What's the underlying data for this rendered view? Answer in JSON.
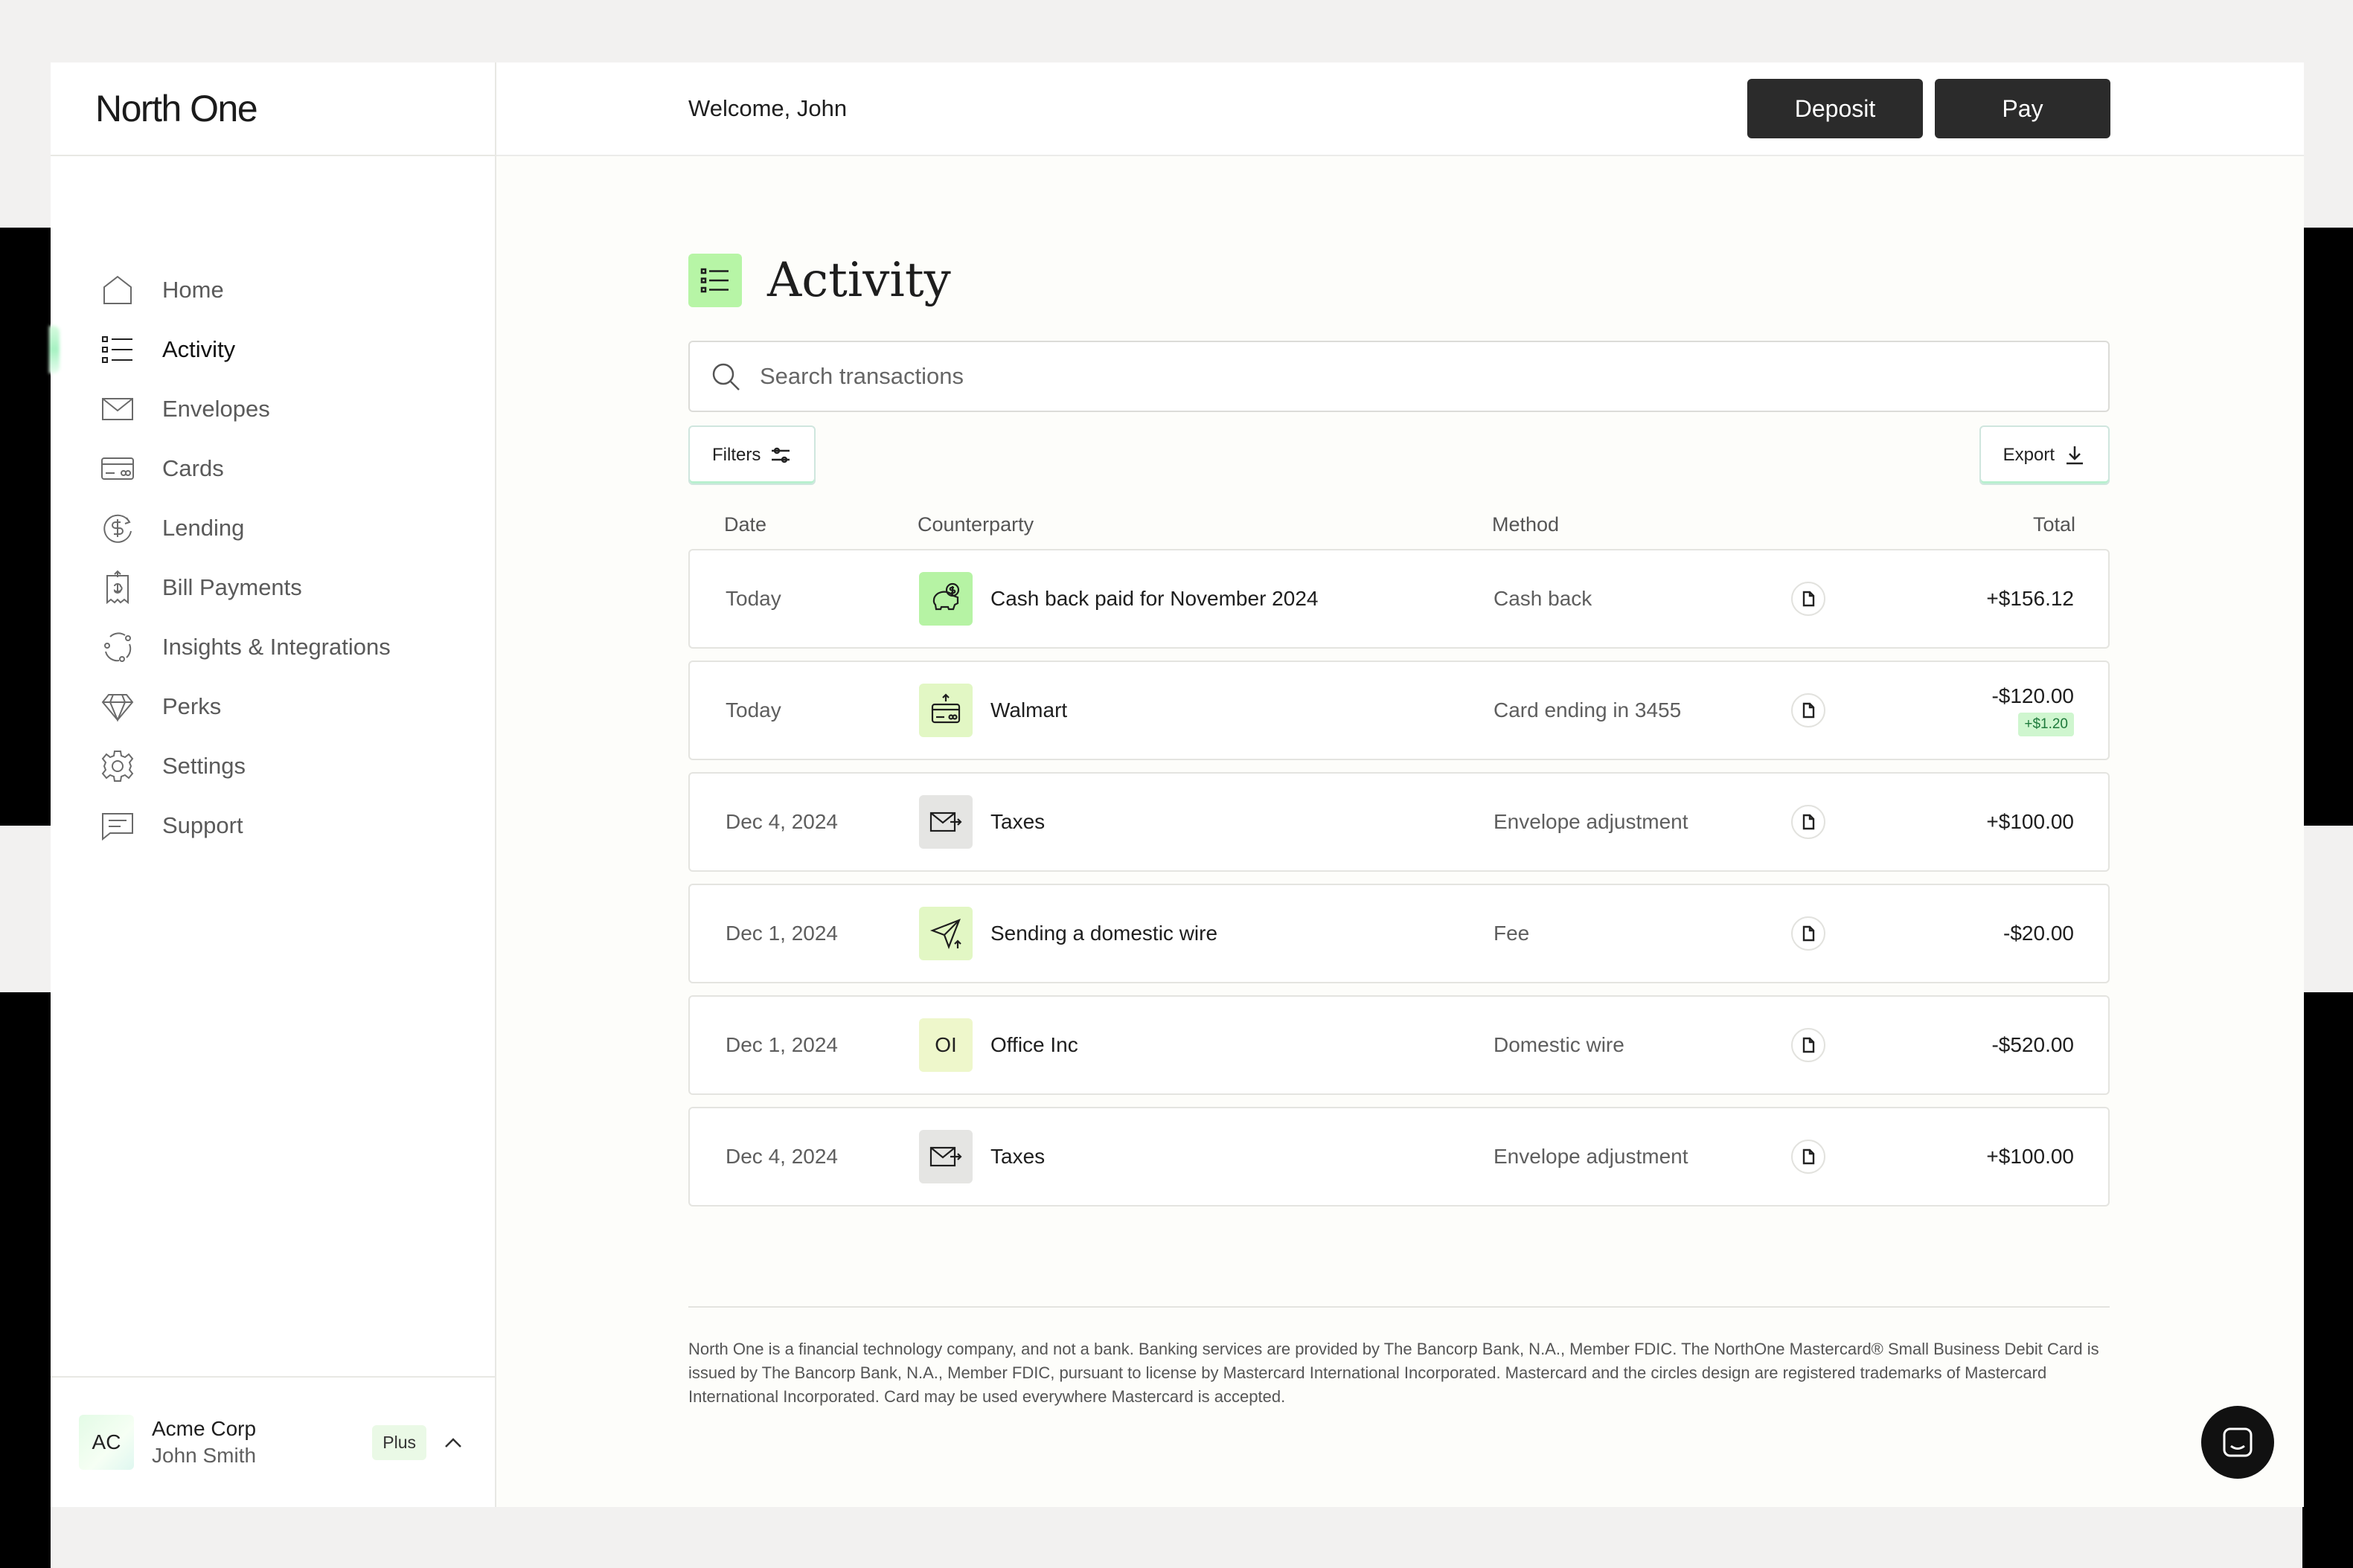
{
  "brand": "North One",
  "header": {
    "welcome": "Welcome, John",
    "deposit_label": "Deposit",
    "pay_label": "Pay"
  },
  "sidebar": {
    "items": [
      {
        "label": "Home",
        "icon": "home-icon"
      },
      {
        "label": "Activity",
        "icon": "list-icon",
        "active": true
      },
      {
        "label": "Envelopes",
        "icon": "envelope-icon"
      },
      {
        "label": "Cards",
        "icon": "card-icon"
      },
      {
        "label": "Lending",
        "icon": "dollar-cycle-icon"
      },
      {
        "label": "Bill Payments",
        "icon": "bill-icon"
      },
      {
        "label": "Insights & Integrations",
        "icon": "integrations-icon"
      },
      {
        "label": "Perks",
        "icon": "diamond-icon"
      },
      {
        "label": "Settings",
        "icon": "gear-icon"
      },
      {
        "label": "Support",
        "icon": "chat-icon"
      }
    ]
  },
  "account": {
    "initials": "AC",
    "company": "Acme Corp",
    "user": "John Smith",
    "plan": "Plus"
  },
  "page": {
    "title": "Activity",
    "search_placeholder": "Search transactions",
    "filters_label": "Filters",
    "export_label": "Export"
  },
  "table": {
    "columns": [
      "Date",
      "Counterparty",
      "Method",
      "Total"
    ],
    "rows": [
      {
        "date": "Today",
        "counterparty": "Cash back paid for November 2024",
        "icon": "piggy-bank-icon",
        "method": "Cash back",
        "total": "+$156.12"
      },
      {
        "date": "Today",
        "counterparty": "Walmart",
        "icon": "card-payment-icon",
        "method": "Card ending in 3455",
        "total": "-$120.00",
        "cashback": "+$1.20"
      },
      {
        "date": "Dec 4, 2024",
        "counterparty": "Taxes",
        "icon": "envelope-transfer-icon",
        "method": "Envelope adjustment",
        "total": "+$100.00"
      },
      {
        "date": "Dec 1, 2024",
        "counterparty": "Sending a domestic wire",
        "icon": "send-icon",
        "method": "Fee",
        "total": "-$20.00"
      },
      {
        "date": "Dec 1, 2024",
        "counterparty": "Office Inc",
        "icon_text": "OI",
        "method": "Domestic wire",
        "total": "-$520.00"
      },
      {
        "date": "Dec 4, 2024",
        "counterparty": "Taxes",
        "icon": "envelope-transfer-icon",
        "method": "Envelope adjustment",
        "total": "+$100.00"
      }
    ]
  },
  "disclaimer": "North One is a financial technology company, and not a bank. Banking services are provided by The Bancorp Bank, N.A., Member FDIC. The NorthOne Mastercard® Small Business Debit Card is issued by The Bancorp Bank, N.A., Member FDIC, pursuant to license by Mastercard International Incorporated. Mastercard and the circles design are registered trademarks of Mastercard International Incorporated. Card may be used everywhere Mastercard is accepted.",
  "colors": {
    "accent_green": "#b6f3a4",
    "button_dark": "#2b2b2b",
    "cashback_badge": "#cff6cf"
  }
}
